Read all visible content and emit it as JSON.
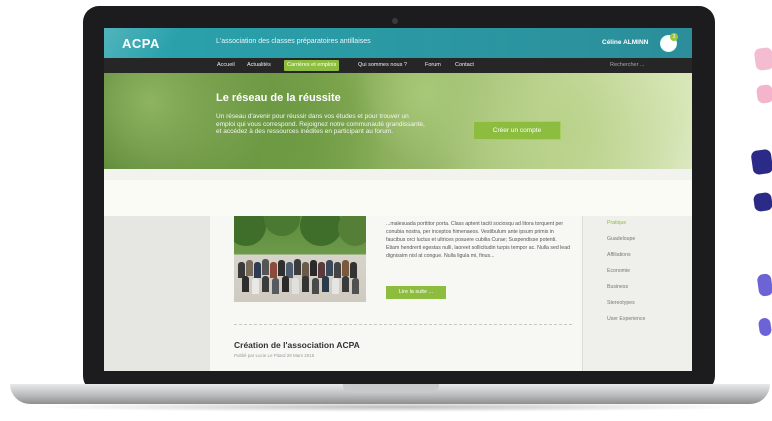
{
  "header": {
    "logo": "ACPA",
    "tagline": "L'association des classes préparatoires antillaises",
    "user_name": "Céline ALMINN",
    "notification_count": "3"
  },
  "nav": {
    "items": [
      {
        "label": "Accueil"
      },
      {
        "label": "Actualités"
      },
      {
        "label": "Carrières et emplois"
      },
      {
        "label": "Qui sommes nous ?"
      },
      {
        "label": "Forum"
      },
      {
        "label": "Contact"
      }
    ],
    "active_index": 2,
    "search_placeholder": "Rechercher ..."
  },
  "hero": {
    "title": "Le réseau de la réussite",
    "text": "Un réseau d'avenir pour réussir dans vos études et pour trouver un emploi qui vous correspond. Rejoignez notre communauté grandissante, et accédez à des ressources inédites en participant au forum.",
    "cta": "Créer un compte"
  },
  "article": {
    "text": "...malesuada porttitor porta. Class aptent taciti sociosqu ad litora torquent per conubia nostra, per inceptos himenaeos. Vestibulum ante ipsum primis in faucibus orci luctus et ultrices posuere cubilia Curae; Suspendisse potenti. Etiam hendrerit egestas nulli, laoreet sollicitudin turpis tempor ac. Nulla sed lead dignissim nisl at congue. Nulla ligula mi, finus...",
    "read_more": "Lire la suite ..."
  },
  "article2": {
    "title": "Création de l'association ACPA",
    "meta": "Publié par Lucie Le Pitard 28 Mars 2015"
  },
  "sidebar": {
    "categories": [
      "Pratique",
      "Guadeloupe",
      "Affiliations",
      "Economie",
      "Business",
      "Stereotypes",
      "User Experience"
    ],
    "active_index": 0
  },
  "colors": {
    "teal": "#2aa3ad",
    "green_accent": "#8cbd3f",
    "nav_dark": "#262626"
  }
}
